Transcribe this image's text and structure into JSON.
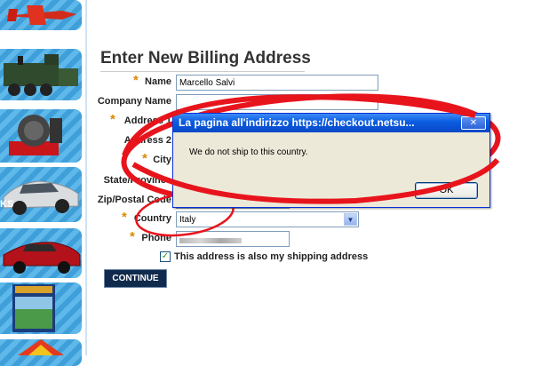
{
  "page": {
    "title": "Enter New Billing Address",
    "sidebar_fragment": "KS"
  },
  "form": {
    "fields": [
      {
        "label": "Name",
        "required": true,
        "value": "Marcello Salvi"
      },
      {
        "label": "Company Name",
        "required": false,
        "value": ""
      },
      {
        "label": "Address 1",
        "required": true,
        "value": ""
      },
      {
        "label": "Address 2",
        "required": false,
        "value": ""
      },
      {
        "label": "City",
        "required": true,
        "value": ""
      },
      {
        "label": "State/Province",
        "required": false,
        "value": ""
      },
      {
        "label": "Zip/Postal Code",
        "required": false,
        "value": ""
      },
      {
        "label": "Country",
        "required": true,
        "value": "Italy"
      },
      {
        "label": "Phone",
        "required": true,
        "value": ""
      }
    ],
    "required_marker": "*",
    "shipping_checkbox_label": "This address is also my shipping address",
    "shipping_checked": true,
    "continue_label": "CONTINUE"
  },
  "dialog": {
    "title": "La pagina all'indirizzo https://checkout.netsu...",
    "close_glyph": "✕",
    "message": "We do not ship to this country.",
    "ok_label": "OK"
  },
  "icons": {
    "dropdown": "chevron-down-icon",
    "check": "checkmark-icon"
  },
  "colors": {
    "title_bar": "#0a5be0",
    "continue_bg": "#102a4c",
    "annotation": "#e8141c",
    "required": "#d98a00"
  }
}
